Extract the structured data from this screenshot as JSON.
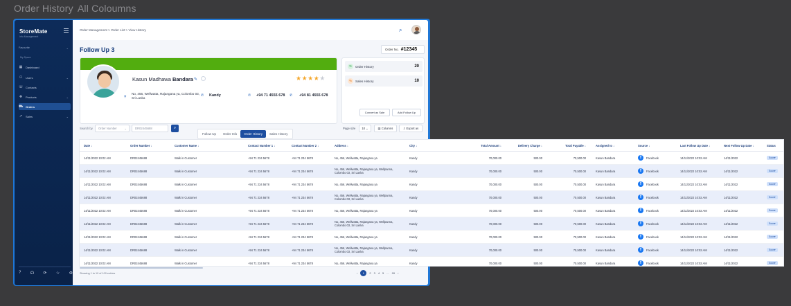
{
  "caption": {
    "title1": "Order History",
    "title2": "All Coloumns"
  },
  "sidebar": {
    "brand": "StoreMate",
    "brand_sub": "Info Management",
    "group1": "Favourite",
    "group2": "My Space",
    "items": [
      {
        "label": "Dashboard",
        "icon": "▦"
      },
      {
        "label": "Users",
        "icon": "⚇"
      },
      {
        "label": "Contacts",
        "icon": "☏"
      },
      {
        "label": "Products",
        "icon": "❖"
      },
      {
        "label": "Orders",
        "icon": "⛟"
      },
      {
        "label": "Sales",
        "icon": "↗"
      }
    ],
    "bottom_icons": [
      "?",
      "☊",
      "⟳",
      "☆",
      "⚙"
    ]
  },
  "topbar": {
    "breadcrumb": "Order Management  >  Order List  >  View History"
  },
  "page": {
    "title": "Follow Up 3",
    "order_no_label": "Order No.",
    "order_no": "#12345"
  },
  "customer": {
    "first": "Kasun Madhawa",
    "last": "Bandara",
    "address": "No, 456, Wellwatta, Rajangana ya, Colombo 03, Sri Lanka",
    "city": "Kandy",
    "phone1": "+94 71 4555 678",
    "phone2": "+94 81 4555 678",
    "rating": 4,
    "rating_max": 5
  },
  "history": {
    "order_label": "Order History",
    "order_count": "20",
    "sales_label": "Sales History",
    "sales_count": "10",
    "convert_btn": "Convert as Sale",
    "followup_btn": "Add Follow Up"
  },
  "tabs": [
    "Follow Up",
    "Order Info",
    "Order History",
    "Sales History"
  ],
  "filters": {
    "search_by": "Search by",
    "field1": "Order Number",
    "field2": "DR02445688",
    "page_size_label": "Page size",
    "page_size": "10",
    "columns_btn": "Columns",
    "export_btn": "Export as"
  },
  "table": {
    "headers": [
      "Date ↓",
      "Order Number ↓",
      "Customer Name ↓",
      "Contact Number 1 ↓",
      "Contact Number 2 ↓",
      "Address ↓",
      "City ↓",
      "Total Amount ↓",
      "Delivery Charge ↓",
      "Total Payable ↓",
      "Assigned to ↓",
      "Source ↓",
      "Last Follow Up Date ↓",
      "Next Follow Up Date ↓",
      "Status"
    ],
    "rows": [
      [
        "14/11/2022 10:02 AM",
        "DR02445688",
        "Walk in Customer",
        "+94 71 234 5678",
        "+94 71 234 5678",
        "No, 456, Wellwatta, Rajangana ya",
        "Kandy",
        "70,000.00",
        "500.00",
        "70,500.00",
        "Kasun Bandara",
        "Facebook",
        "14/11/2022 10:02 AM",
        "14/11/2022",
        "Soon"
      ],
      [
        "14/11/2022 10:02 AM",
        "DR02445688",
        "Walk in Customer",
        "+94 71 234 5678",
        "+94 71 234 5678",
        "No, 456, Wellwatta, Rajangana ya, Wellpanna, Colombo 03, Sri Lanka",
        "Kandy",
        "70,000.00",
        "500.00",
        "70,500.00",
        "Kasun Bandara",
        "Facebook",
        "14/11/2022 10:02 AM",
        "14/11/2022",
        "Soon"
      ],
      [
        "14/11/2022 10:02 AM",
        "DR02445688",
        "Walk in Customer",
        "+94 71 234 5678",
        "+94 71 234 5678",
        "No, 456, Wellwatta, Rajangana ya",
        "Kandy",
        "70,000.00",
        "500.00",
        "70,500.00",
        "Kasun Bandara",
        "Facebook",
        "14/11/2022 10:02 AM",
        "14/11/2022",
        "Soon"
      ],
      [
        "14/11/2022 10:02 AM",
        "DR02445688",
        "Walk in Customer",
        "+94 71 234 5678",
        "+94 71 234 5678",
        "No, 456, Wellwatta, Rajangana ya, Wellpanna, Colombo 03, Sri Lanka",
        "Kandy",
        "70,000.00",
        "500.00",
        "70,500.00",
        "Kasun Bandara",
        "Facebook",
        "14/11/2022 10:02 AM",
        "14/11/2022",
        "Soon"
      ],
      [
        "14/11/2022 10:02 AM",
        "DR02445688",
        "Walk in Customer",
        "+94 71 234 5678",
        "+94 71 234 5678",
        "No, 456, Wellwatta, Rajangana ya",
        "Kandy",
        "70,000.00",
        "500.00",
        "70,500.00",
        "Kasun Bandara",
        "Facebook",
        "14/11/2022 10:02 AM",
        "14/11/2022",
        "Soon"
      ],
      [
        "14/11/2022 10:02 AM",
        "DR02445688",
        "Walk in Customer",
        "+94 71 234 5678",
        "+94 71 234 5678",
        "No, 456, Wellwatta, Rajangana ya, Wellpanna, Colombo 03, Sri Lanka",
        "Kandy",
        "70,000.00",
        "500.00",
        "70,500.00",
        "Kasun Bandara",
        "Facebook",
        "14/11/2022 10:02 AM",
        "14/11/2022",
        "Soon"
      ],
      [
        "14/11/2022 10:02 AM",
        "DR02445688",
        "Walk in Customer",
        "+94 71 234 5678",
        "+94 71 234 5678",
        "No, 456, Wellwatta, Rajangana ya",
        "Kandy",
        "70,000.00",
        "500.00",
        "70,500.00",
        "Kasun Bandara",
        "Facebook",
        "14/11/2022 10:02 AM",
        "14/11/2022",
        "Soon"
      ],
      [
        "14/11/2022 10:02 AM",
        "DR02445688",
        "Walk in Customer",
        "+94 71 234 5678",
        "+94 71 234 5678",
        "No, 456, Wellwatta, Rajangana ya, Wellpanna, Colombo 03, Sri Lanka",
        "Kandy",
        "70,000.00",
        "500.00",
        "70,500.00",
        "Kasun Bandara",
        "Facebook",
        "14/11/2022 10:02 AM",
        "14/11/2022",
        "Soon"
      ],
      [
        "14/11/2022 10:02 AM",
        "DR02445688",
        "Walk in Customer",
        "+94 71 234 5678",
        "+94 71 234 5678",
        "No, 456, Wellwatta, Rajangana ya",
        "Kandy",
        "70,000.00",
        "500.00",
        "70,500.00",
        "Kasun Bandara",
        "Facebook",
        "14/11/2022 10:02 AM",
        "14/11/2022",
        "Soon"
      ]
    ]
  },
  "footer": {
    "showing": "Showing 1 to 10 of 100 entries",
    "pages": [
      "1",
      "2",
      "3",
      "4",
      "5",
      "...",
      "99"
    ]
  }
}
